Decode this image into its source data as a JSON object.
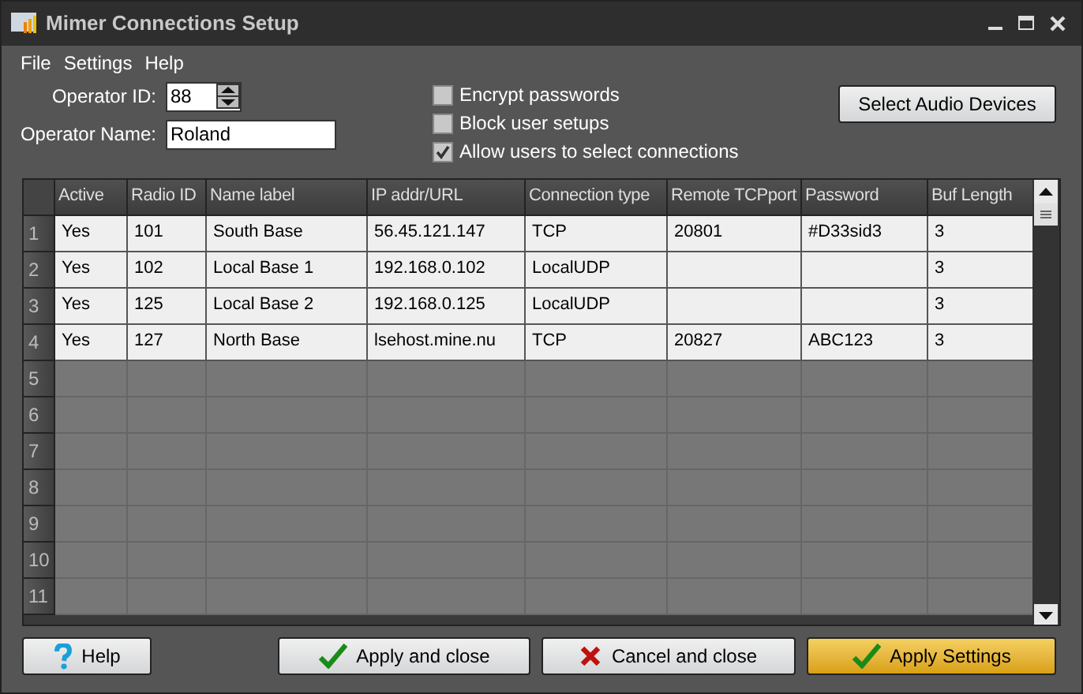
{
  "window": {
    "title": "Mimer Connections Setup"
  },
  "menu": [
    "File",
    "Settings",
    "Help"
  ],
  "operator_id": {
    "label": "Operator ID:",
    "value": "88"
  },
  "operator_name": {
    "label": "Operator Name:",
    "value": "Roland"
  },
  "options": [
    {
      "label": "Encrypt passwords",
      "checked": false
    },
    {
      "label": "Block user setups",
      "checked": false
    },
    {
      "label": "Allow users to select connections",
      "checked": true
    }
  ],
  "audio_button": "Select Audio Devices",
  "table": {
    "columns": [
      "Active",
      "Radio ID",
      "Name label",
      "IP addr/URL",
      "Connection type",
      "Remote TCPport",
      "Password",
      "Buf Length"
    ],
    "rows": [
      {
        "number": "1",
        "cells": [
          "Yes",
          "101",
          "South Base",
          "56.45.121.147",
          "TCP",
          "20801",
          "#D33sid3",
          "3"
        ]
      },
      {
        "number": "2",
        "cells": [
          "Yes",
          "102",
          "Local Base 1",
          "192.168.0.102",
          "LocalUDP",
          null,
          null,
          "3"
        ]
      },
      {
        "number": "3",
        "cells": [
          "Yes",
          "125",
          "Local Base 2",
          "192.168.0.125",
          "LocalUDP",
          null,
          null,
          "3"
        ]
      },
      {
        "number": "4",
        "cells": [
          "Yes",
          "127",
          "North Base",
          "lsehost.mine.nu",
          "TCP",
          "20827",
          "ABC123",
          "3"
        ]
      },
      {
        "number": "5"
      },
      {
        "number": "6"
      },
      {
        "number": "7"
      },
      {
        "number": "8"
      },
      {
        "number": "9"
      },
      {
        "number": "10"
      },
      {
        "number": "11"
      }
    ]
  },
  "buttons": [
    {
      "label": "Help",
      "kind": "help",
      "default": false
    },
    {
      "label": "Apply and close",
      "kind": "confirm",
      "default": false
    },
    {
      "label": "Cancel and close",
      "kind": "cancel",
      "default": false
    },
    {
      "label": "Apply Settings",
      "kind": "confirm",
      "default": true
    }
  ]
}
